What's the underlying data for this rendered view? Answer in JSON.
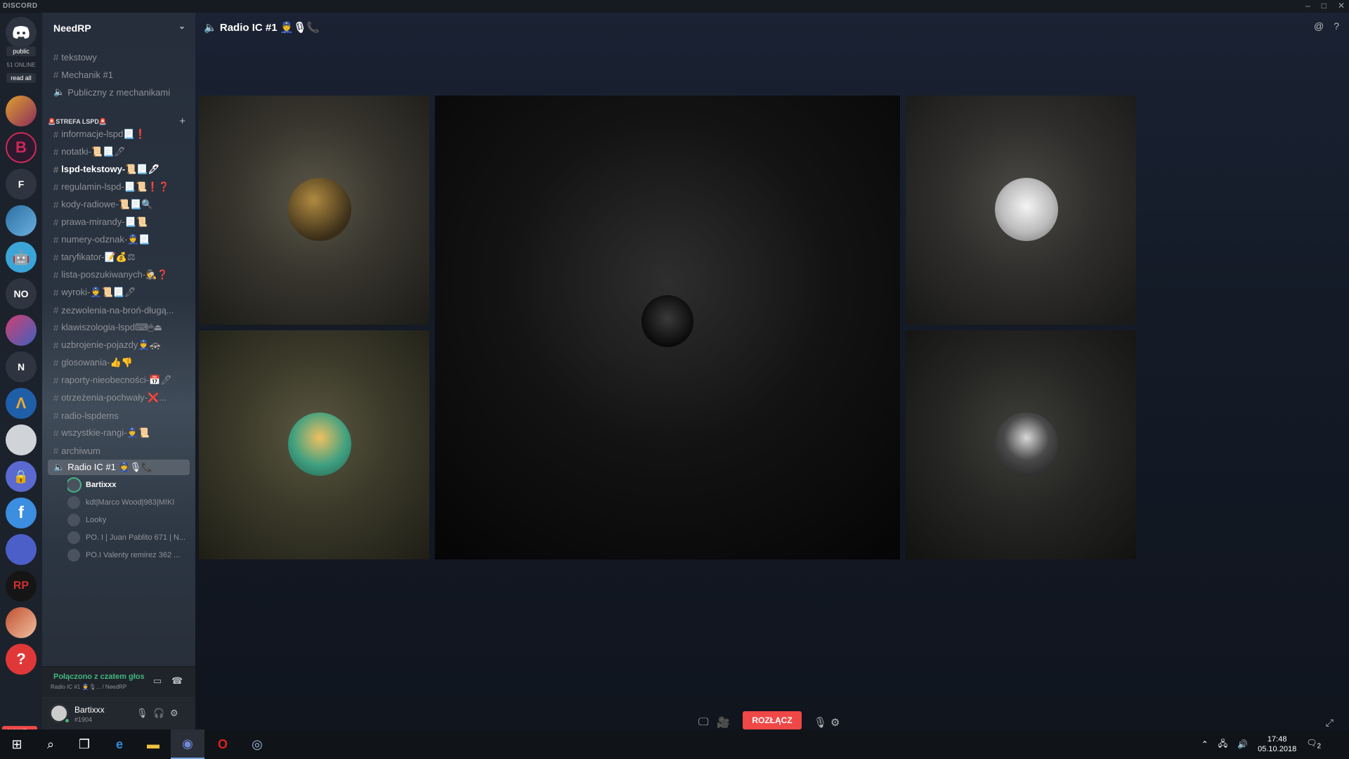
{
  "window": {
    "brand": "DISCORD",
    "controls": [
      "–",
      "□",
      "✕"
    ]
  },
  "guild_bar": {
    "pill_public": "public",
    "online_count": "51 ONLINE",
    "pill_read_all": "read all",
    "letters": [
      "F",
      "NO",
      "N"
    ],
    "nowe_label": "NOWE ↓"
  },
  "server": {
    "name": "NeedRP"
  },
  "channels_top": [
    {
      "name": "tekstowy",
      "icon": "text"
    },
    {
      "name": "Mechanik #1",
      "icon": "voice"
    },
    {
      "name": "Publiczny z mechanikami",
      "icon": "voice"
    }
  ],
  "category": {
    "name": "🚨STREFA LSPD🚨"
  },
  "channels": [
    {
      "name": "informacje-lspd📃❗"
    },
    {
      "name": "notatki-📜📃🖊"
    },
    {
      "name": "lspd-tekstowy-📜📃🖊",
      "unread": true
    },
    {
      "name": "regulamin-lspd-📃📜❗❓"
    },
    {
      "name": "kody-radiowe-📜📃🔍"
    },
    {
      "name": "prawa-mirandy-📃📜"
    },
    {
      "name": "numery-odznak-👮📃"
    },
    {
      "name": "taryfikator-📝💰⚖"
    },
    {
      "name": "lista-poszukiwanych-🕵❓"
    },
    {
      "name": "wyroki-👮📜📃🖊"
    },
    {
      "name": "zezwolenia-na-broń-długą..."
    },
    {
      "name": "klawiszologia-lspd⌨🖱⏏"
    },
    {
      "name": "uzbrojenie-pojazdy👮🚓"
    },
    {
      "name": "glosowania-👍👎"
    },
    {
      "name": "raporty-nieobecności-📅🖊"
    },
    {
      "name": "otrzeżenia-pochwały-❌..."
    },
    {
      "name": "radio-lspdems"
    },
    {
      "name": "wszystkie-rangi-👮📜"
    },
    {
      "name": "archiwum"
    }
  ],
  "active_voice": {
    "name": "Radio IC #1 👮🎙📞"
  },
  "voice_users": [
    {
      "name": "Bartixxx",
      "me": true
    },
    {
      "name": "kdt|Marco Wood|983|MIKI"
    },
    {
      "name": "Looky"
    },
    {
      "name": "PO. I | Juan Pablito 671 | N..."
    },
    {
      "name": "PO.I Valenty remirez 362 ..."
    }
  ],
  "voice_panel": {
    "status": "Połączono z czatem głos",
    "sub": "Radio IC #1 👮🎙... / NeedRP"
  },
  "user": {
    "name": "Bartixxx",
    "discriminator": "#1904"
  },
  "main": {
    "title": "Radio IC #1 👮🎙📞",
    "disconnect_label": "ROZŁĄCZ"
  },
  "taskbar": {
    "time": "17:48",
    "date": "05.10.2018",
    "notifications": "2"
  },
  "colors": {
    "green": "#43b581",
    "red": "#f04747",
    "blurple": "#7289da"
  }
}
